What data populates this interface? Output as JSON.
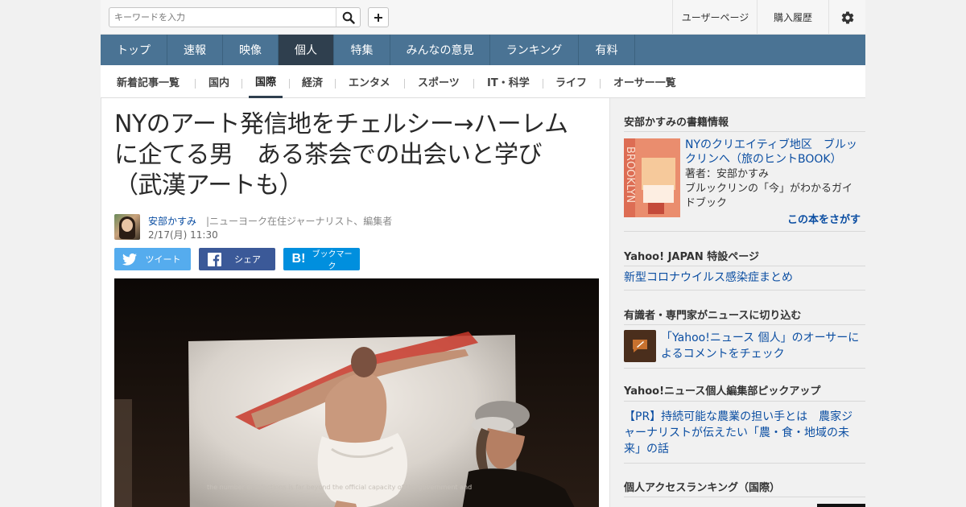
{
  "search": {
    "placeholder": "キーワードを入力"
  },
  "top_links": {
    "user_page": "ユーザーページ",
    "purchase_history": "購入履歴"
  },
  "nav": [
    {
      "label": "トップ"
    },
    {
      "label": "速報"
    },
    {
      "label": "映像"
    },
    {
      "label": "個人",
      "active": true
    },
    {
      "label": "特集"
    },
    {
      "label": "みんなの意見"
    },
    {
      "label": "ランキング"
    },
    {
      "label": "有料"
    }
  ],
  "subnav": [
    {
      "label": "新着記事一覧"
    },
    {
      "label": "国内"
    },
    {
      "label": "国際",
      "active": true
    },
    {
      "label": "経済"
    },
    {
      "label": "エンタメ"
    },
    {
      "label": "スポーツ"
    },
    {
      "label": "IT・科学"
    },
    {
      "label": "ライフ"
    },
    {
      "label": "オーサー一覧"
    }
  ],
  "article": {
    "title_lines": [
      "NYのアート発信地をチェルシー→ハーレム",
      "に企てる男　ある茶会での出会いと学び",
      "（武漢アートも）"
    ],
    "author": "安部かすみ",
    "author_desc": "|ニューヨーク在住ジャーナリスト、編集者",
    "date": "2/17(月) 11:30",
    "share": {
      "tweet": "ツイート",
      "share": "シェア",
      "bookmark": "ブックマーク"
    },
    "photo_caption": "the number of infections is far beyond the official capacity of the government and"
  },
  "sidebar": {
    "book_heading": "安部かすみの書籍情報",
    "book_title": "NYのクリエイティブ地区　ブルックリンへ（旅のヒントBOOK）",
    "book_author": "著者：安部かすみ",
    "book_desc": "ブルックリンの「今」がわかるガイドブック",
    "book_search": "この本をさがす",
    "special_heading": "Yahoo! JAPAN 特設ページ",
    "special_link": "新型コロナウイルス感染症まとめ",
    "expert_heading": "有識者・専門家がニュースに切り込む",
    "expert_link": "「Yahoo!ニュース 個人」のオーサーによるコメントをチェック",
    "pickup_heading": "Yahoo!ニュース個人編集部ピックアップ",
    "pickup_link": "【PR】持続可能な農業の担い手とは　農家ジャーナリストが伝えたい「農・食・地域の未来」の話",
    "ranking_heading": "個人アクセスランキング（国際）"
  },
  "colors": {
    "nav_bg": "#4a7394",
    "nav_active": "#2f3f4e",
    "link": "#0b4ea2",
    "twitter": "#55acee",
    "facebook": "#3b5998",
    "hatena": "#008fde"
  }
}
